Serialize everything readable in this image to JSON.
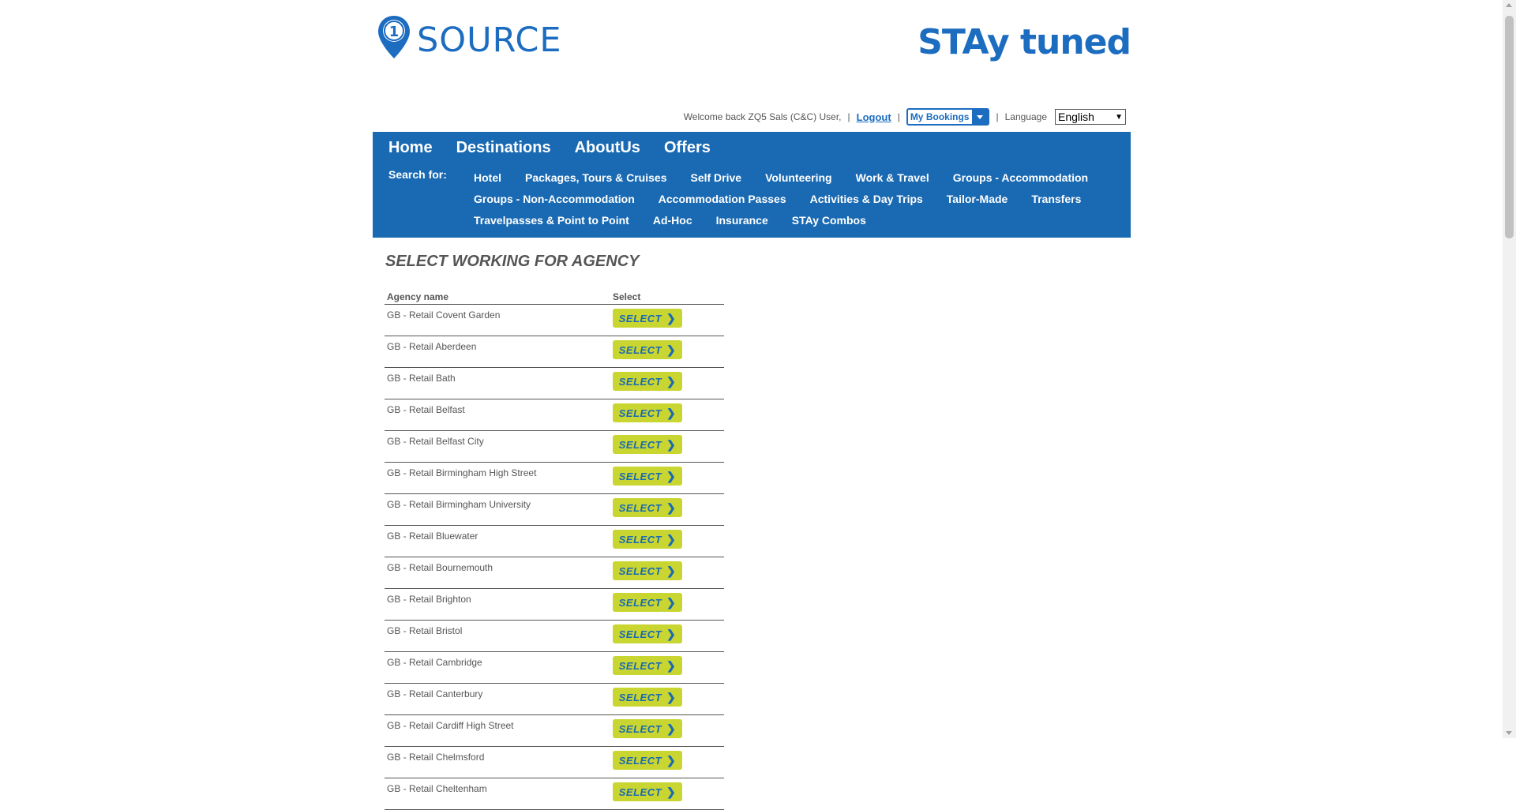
{
  "brand": {
    "left_logo_text": "SOURCE",
    "left_logo_badge": "1",
    "right_logo_text": "STAy tuned",
    "primary_color": "#1a6ab3",
    "button_color": "#c9d531"
  },
  "userbar": {
    "welcome": "Welcome back ZQ5 Sals (C&C) User,",
    "logout": "Logout",
    "my_bookings": "My Bookings",
    "language_label": "Language",
    "language_value": "English"
  },
  "mainnav": [
    "Home",
    "Destinations",
    "AboutUs",
    "Offers"
  ],
  "search_for_label": "Search for:",
  "search_links": [
    [
      "Hotel",
      "Packages, Tours & Cruises",
      "Self Drive",
      "Volunteering",
      "Work & Travel",
      "Groups - Accommodation"
    ],
    [
      "Groups - Non-Accommodation",
      "Accommodation Passes",
      "Activities & Day Trips",
      "Tailor-Made",
      "Transfers"
    ],
    [
      "Travelpasses & Point to Point",
      "Ad-Hoc",
      "Insurance",
      "STAy Combos"
    ]
  ],
  "page_title": "SELECT WORKING FOR AGENCY",
  "table": {
    "headers": [
      "Agency name",
      "Select"
    ],
    "button_label": "SELECT",
    "rows": [
      "GB - Retail Covent Garden",
      "GB - Retail Aberdeen",
      "GB - Retail Bath",
      "GB - Retail Belfast",
      "GB - Retail Belfast City",
      "GB - Retail Birmingham High Street",
      "GB - Retail Birmingham University",
      "GB - Retail Bluewater",
      "GB - Retail Bournemouth",
      "GB - Retail Brighton",
      "GB - Retail Bristol",
      "GB - Retail Cambridge",
      "GB - Retail Canterbury",
      "GB - Retail Cardiff High Street",
      "GB - Retail Chelmsford",
      "GB - Retail Cheltenham"
    ]
  }
}
